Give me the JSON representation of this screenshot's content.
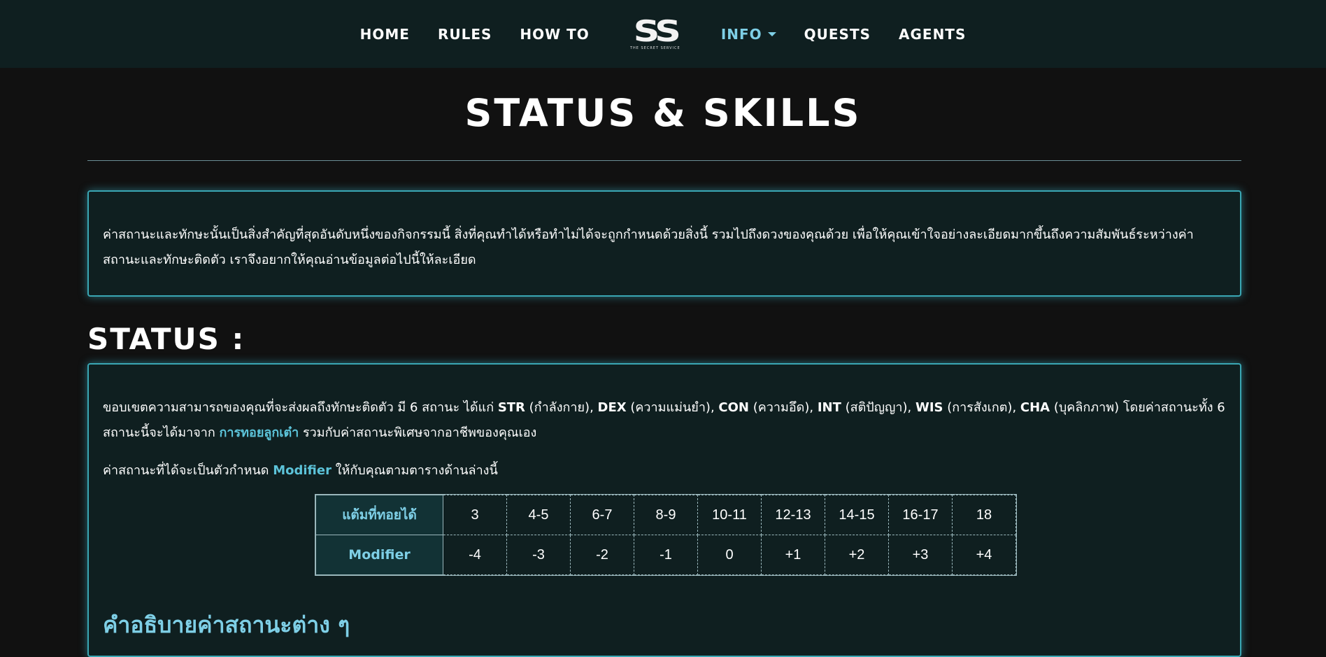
{
  "nav": {
    "home": "HOME",
    "rules": "RULES",
    "howto": "HOW TO",
    "logo_text": "SS",
    "logo_sub": "THE SECRET SERVICE",
    "info": "INFO",
    "quests": "QUESTS",
    "agents": "AGENTS"
  },
  "page_title": "STATUS & SKILLS",
  "intro": {
    "text": "ค่าสถานะและทักษะนั้นเป็นสิ่งสำคัญที่สุดอันดับหนึ่งของกิจกรรมนี้    สิ่งที่คุณทำได้หรือทำไม่ได้จะถูกกำหนดด้วยสิ่งนี้    รวมไปถึงดวงของคุณด้วย    เพื่อให้คุณเข้าใจอย่างละเอียดมากขึ้นถึงความสัมพันธ์ระหว่างค่าสถานะและทักษะติดตัว เราจึงอยากให้คุณอ่านข้อมูลต่อไปนี้ให้ละเอียด"
  },
  "status": {
    "heading": "STATUS :",
    "p1_a": "ขอบเขตความสามารถของคุณที่จะส่งผลถึงทักษะติดตัว มี 6 สถานะ ได้แก่ ",
    "str": "STR",
    "str_desc": " (กำลังกาย), ",
    "dex": "DEX",
    "dex_desc": " (ความแม่นยำ), ",
    "con": "CON",
    "con_desc": " (ความอึด), ",
    "int": "INT",
    "int_desc": " (สติปัญญา), ",
    "wis": "WIS",
    "wis_desc": " (การสังเกต), ",
    "cha": "CHA",
    "cha_desc": " (บุคลิกภาพ) โดยค่าสถานะทั้ง 6 สถานะนี้จะได้มาจาก ",
    "dice_link": "การทอยลูกเต๋า",
    "p1_end": " รวมกับค่าสถานะพิเศษจากอาชีพของคุณเอง",
    "p2_a": "ค่าสถานะที่ได้จะเป็นตัวกำหนด ",
    "modifier_word": "Modifier",
    "p2_b": " ให้กับคุณตามตารางด้านล่างนี้",
    "table": {
      "row1_header": "แต้มที่ทอยได้",
      "row2_header": "Modifier",
      "rolls": [
        "3",
        "4-5",
        "6-7",
        "8-9",
        "10-11",
        "12-13",
        "14-15",
        "16-17",
        "18"
      ],
      "modifiers": [
        "-4",
        "-3",
        "-2",
        "-1",
        "0",
        "+1",
        "+2",
        "+3",
        "+4"
      ]
    },
    "subheading": "คำอธิบายค่าสถานะต่าง ๆ"
  }
}
